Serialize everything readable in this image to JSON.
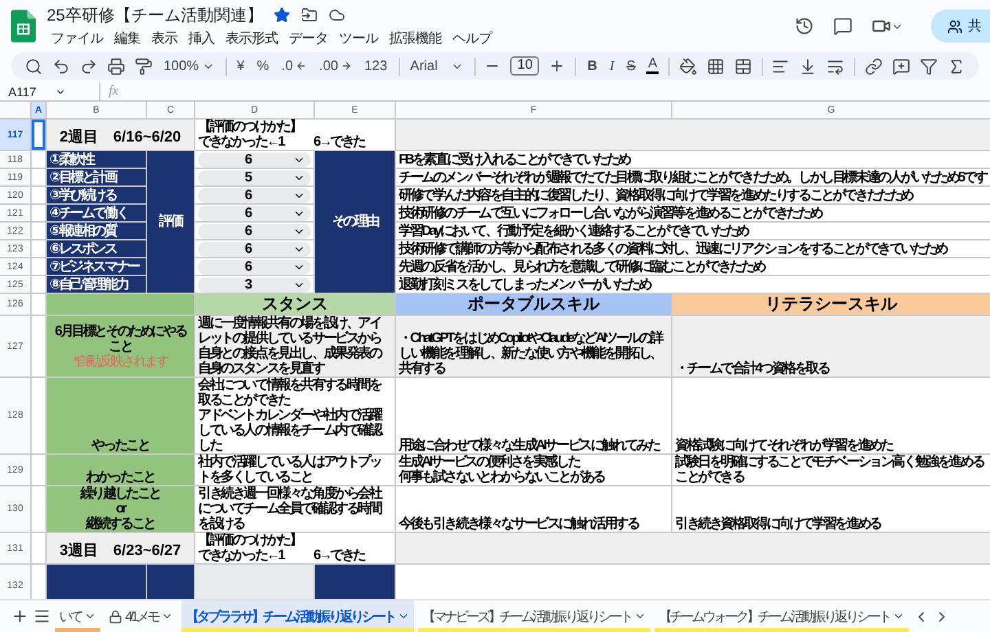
{
  "document": {
    "title": "25卒研修【チーム活動関連】",
    "starred": true,
    "share_label": "共"
  },
  "menu": [
    "ファイル",
    "編集",
    "表示",
    "挿入",
    "表示形式",
    "データ",
    "ツール",
    "拡張機能",
    "ヘルプ"
  ],
  "toolbar": {
    "zoom": "100%",
    "currency": "¥",
    "percent": "%",
    "decimal_less": ".0",
    "decimal_more": ".00",
    "number_format": "123",
    "font": "Arial",
    "font_size": "10",
    "bold": "B",
    "italic": "I",
    "strike": "S",
    "text_color": "A"
  },
  "formula_bar": {
    "name_box": "A117",
    "fx": "fx"
  },
  "columns": [
    {
      "label": "A",
      "selected": true
    },
    {
      "label": "B",
      "selected": false
    },
    {
      "label": "C",
      "selected": false
    },
    {
      "label": "D",
      "selected": false
    },
    {
      "label": "E",
      "selected": false
    },
    {
      "label": "F",
      "selected": false
    },
    {
      "label": "G",
      "selected": false
    }
  ],
  "week2": {
    "row": "117",
    "selected": true,
    "title": "2週目　6/16~6/20",
    "guide": {
      "heading": "【評価のつけかた】",
      "low": "できなかった←1",
      "high": "6→できた"
    },
    "rating_label": "評価",
    "reason_label": "その理由",
    "items": [
      {
        "row": "118",
        "skill": "①柔軟性",
        "score": "6",
        "reason": "FBを素直に受け入れることができていたため"
      },
      {
        "row": "119",
        "skill": "②目標と計画",
        "score": "5",
        "reason": "チームのメンバーそれぞれが週報でたてた目標に取り組むことができたため。しかし目標未達の人がいたため5です"
      },
      {
        "row": "120",
        "skill": "③学び続ける",
        "score": "6",
        "reason": "研修で学んだ内容を自主的に復習したり、資格取得に向けて学習を進めたりすることができたたため"
      },
      {
        "row": "121",
        "skill": "④チームで働く",
        "score": "6",
        "reason": "技術研修のチームで互いにフォローし合いながら演習等を進めることができたため"
      },
      {
        "row": "122",
        "skill": "⑤報連相の質",
        "score": "6",
        "reason": "学習Dayにおいて、行動予定を細かく連絡することができていたため"
      },
      {
        "row": "123",
        "skill": "⑥レスポンス",
        "score": "6",
        "reason": "技術研修で講師の方等から配布される多くの資料に対し、迅速にリアクションをすることができていたため"
      },
      {
        "row": "124",
        "skill": "⑦ビジネスマナー",
        "score": "6",
        "reason": "先週の反省を活かし、見られ方を意識して研修に臨むことができたため"
      },
      {
        "row": "125",
        "skill": "⑧自己管理能力",
        "score": "3",
        "reason": "退勤打刻ミスをしてしまったメンバーがいたため"
      }
    ]
  },
  "goals": {
    "row": "126",
    "headers": [
      {
        "label": "スタンス",
        "color": "#b6d7a8"
      },
      {
        "label": "ポータブルスキル",
        "color": "#a4c2f4"
      },
      {
        "label": "リテラシースキル",
        "color": "#f9cb9c"
      }
    ],
    "rows": [
      {
        "row": "127",
        "label": [
          "6月目標とそのためにやること"
        ],
        "note": "*自動反映されます",
        "auto_filled": true,
        "cells": [
          [
            "週に一度情報共有の場を設け、アイレットの提供しているサービスから自身との接点を見出し、成果発表の自身のスタンスを見直す"
          ],
          [
            "・ChatGPTをはじめCopilotやClaudeなどAIツールの詳しい機能を理解し、新たな使い方や機能を開拓し、共有する"
          ],
          [
            "・チームで合計4つ資格を取る"
          ]
        ]
      },
      {
        "row": "128",
        "label": [
          "やったこと"
        ],
        "auto_filled": false,
        "cells": [
          [
            "会社について情報を共有する時間を取ることができた",
            "アドベントカレンダーや社内で活躍している人の情報をチーム内で確認した"
          ],
          [
            "用途に合わせて様々な生成AIサービスに触れてみた"
          ],
          [
            "資格試験に向けてそれぞれが学習を進めた"
          ]
        ]
      },
      {
        "row": "129",
        "label": [
          "わかったこと"
        ],
        "auto_filled": false,
        "cells": [
          [
            "社内で活躍している人はアウトプットを多くしていること"
          ],
          [
            "生成AIサービスの便利さを実感した",
            "何事も試さないとわからないことがある"
          ],
          [
            "試験日を明確にすることでモチベーション高く勉強を進めることができる"
          ]
        ]
      },
      {
        "row": "130",
        "label": [
          "繰り越したこと",
          "or",
          "継続すること"
        ],
        "auto_filled": false,
        "cells": [
          [
            "引き続き週一回様々な角度から会社についてチーム全員で確認する時間を設ける"
          ],
          [
            "今後も引き続き様々なサービスに触れ活用する"
          ],
          [
            "引き続き資格取得に向けて学習を進める"
          ]
        ]
      }
    ]
  },
  "week3": {
    "row": "131",
    "title": "3週目　6/23~6/27",
    "guide": {
      "heading": "【評価のつけかた】",
      "low": "できなかった←1",
      "high": "6→できた"
    }
  },
  "next_row": "132",
  "sheet_tabs": [
    {
      "label": "いて",
      "selected": false,
      "locked": false,
      "color": "#f6b26b"
    },
    {
      "label": "4/1メモ",
      "selected": false,
      "locked": true
    },
    {
      "label": "【タブララサ】チーム活動振り返りシート",
      "selected": true,
      "locked": false,
      "color": "#ffe94d"
    },
    {
      "label": "【マナビーズ】チーム活動振り返りシート",
      "selected": false,
      "locked": false,
      "color": "#ffe94d"
    },
    {
      "label": "【チームウォーク】チーム活動振り返りシート",
      "selected": false,
      "locked": false,
      "color": "#ffe94d"
    }
  ]
}
